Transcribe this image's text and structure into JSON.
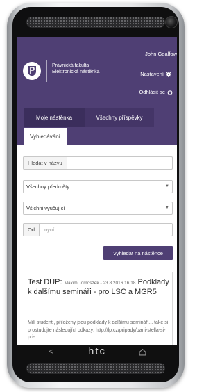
{
  "device": {
    "brand": "htc",
    "nav_back_icon": "back-arrow-icon",
    "nav_home_icon": "home-icon"
  },
  "header": {
    "faculty_line1": "Právnická fakulta",
    "faculty_line2": "Elektronická nástěnka",
    "user_name": "John Gealfow",
    "settings_label": "Nastavení",
    "settings_icon": "gear-icon",
    "logout_label": "Odhlásit se",
    "logout_icon": "power-icon",
    "logo": "university-seal-logo",
    "background": "#4f3f74"
  },
  "tabs": [
    {
      "label": "Moje nástěnka"
    },
    {
      "label": "Všechny příspěvky"
    },
    {
      "label": "Vyhledávání",
      "active": true
    }
  ],
  "search": {
    "title_label": "Hledat v názvu",
    "subject_value": "Všechny předměty",
    "teacher_value": "Všichni vyučující",
    "from_label": "Od",
    "from_value": "nyní",
    "submit_label": "Vyhledat na nástěnce"
  },
  "post": {
    "title": "Test DUP: Podklady k dalšímu semináři - pro LSC a MGR5",
    "title_start": "Test DUP:",
    "title_rest": "Podklady k dalšímu semináři - pro LSC a MGR5",
    "meta": "Maxim Tomoszek - 23.8.2016 16:18",
    "excerpt": "Milí studenti, přiloženy jsou podklady k dalšímu semináři... také si prostudujte následující odkazy: http://lp.cz/pripady/pani-stella-si-pri-"
  }
}
